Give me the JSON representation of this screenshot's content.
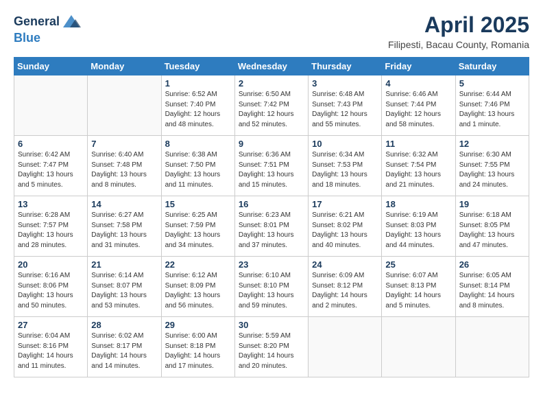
{
  "header": {
    "logo_general": "General",
    "logo_blue": "Blue",
    "title": "April 2025",
    "subtitle": "Filipesti, Bacau County, Romania"
  },
  "weekdays": [
    "Sunday",
    "Monday",
    "Tuesday",
    "Wednesday",
    "Thursday",
    "Friday",
    "Saturday"
  ],
  "weeks": [
    [
      {
        "day": "",
        "detail": ""
      },
      {
        "day": "",
        "detail": ""
      },
      {
        "day": "1",
        "detail": "Sunrise: 6:52 AM\nSunset: 7:40 PM\nDaylight: 12 hours\nand 48 minutes."
      },
      {
        "day": "2",
        "detail": "Sunrise: 6:50 AM\nSunset: 7:42 PM\nDaylight: 12 hours\nand 52 minutes."
      },
      {
        "day": "3",
        "detail": "Sunrise: 6:48 AM\nSunset: 7:43 PM\nDaylight: 12 hours\nand 55 minutes."
      },
      {
        "day": "4",
        "detail": "Sunrise: 6:46 AM\nSunset: 7:44 PM\nDaylight: 12 hours\nand 58 minutes."
      },
      {
        "day": "5",
        "detail": "Sunrise: 6:44 AM\nSunset: 7:46 PM\nDaylight: 13 hours\nand 1 minute."
      }
    ],
    [
      {
        "day": "6",
        "detail": "Sunrise: 6:42 AM\nSunset: 7:47 PM\nDaylight: 13 hours\nand 5 minutes."
      },
      {
        "day": "7",
        "detail": "Sunrise: 6:40 AM\nSunset: 7:48 PM\nDaylight: 13 hours\nand 8 minutes."
      },
      {
        "day": "8",
        "detail": "Sunrise: 6:38 AM\nSunset: 7:50 PM\nDaylight: 13 hours\nand 11 minutes."
      },
      {
        "day": "9",
        "detail": "Sunrise: 6:36 AM\nSunset: 7:51 PM\nDaylight: 13 hours\nand 15 minutes."
      },
      {
        "day": "10",
        "detail": "Sunrise: 6:34 AM\nSunset: 7:53 PM\nDaylight: 13 hours\nand 18 minutes."
      },
      {
        "day": "11",
        "detail": "Sunrise: 6:32 AM\nSunset: 7:54 PM\nDaylight: 13 hours\nand 21 minutes."
      },
      {
        "day": "12",
        "detail": "Sunrise: 6:30 AM\nSunset: 7:55 PM\nDaylight: 13 hours\nand 24 minutes."
      }
    ],
    [
      {
        "day": "13",
        "detail": "Sunrise: 6:28 AM\nSunset: 7:57 PM\nDaylight: 13 hours\nand 28 minutes."
      },
      {
        "day": "14",
        "detail": "Sunrise: 6:27 AM\nSunset: 7:58 PM\nDaylight: 13 hours\nand 31 minutes."
      },
      {
        "day": "15",
        "detail": "Sunrise: 6:25 AM\nSunset: 7:59 PM\nDaylight: 13 hours\nand 34 minutes."
      },
      {
        "day": "16",
        "detail": "Sunrise: 6:23 AM\nSunset: 8:01 PM\nDaylight: 13 hours\nand 37 minutes."
      },
      {
        "day": "17",
        "detail": "Sunrise: 6:21 AM\nSunset: 8:02 PM\nDaylight: 13 hours\nand 40 minutes."
      },
      {
        "day": "18",
        "detail": "Sunrise: 6:19 AM\nSunset: 8:03 PM\nDaylight: 13 hours\nand 44 minutes."
      },
      {
        "day": "19",
        "detail": "Sunrise: 6:18 AM\nSunset: 8:05 PM\nDaylight: 13 hours\nand 47 minutes."
      }
    ],
    [
      {
        "day": "20",
        "detail": "Sunrise: 6:16 AM\nSunset: 8:06 PM\nDaylight: 13 hours\nand 50 minutes."
      },
      {
        "day": "21",
        "detail": "Sunrise: 6:14 AM\nSunset: 8:07 PM\nDaylight: 13 hours\nand 53 minutes."
      },
      {
        "day": "22",
        "detail": "Sunrise: 6:12 AM\nSunset: 8:09 PM\nDaylight: 13 hours\nand 56 minutes."
      },
      {
        "day": "23",
        "detail": "Sunrise: 6:10 AM\nSunset: 8:10 PM\nDaylight: 13 hours\nand 59 minutes."
      },
      {
        "day": "24",
        "detail": "Sunrise: 6:09 AM\nSunset: 8:12 PM\nDaylight: 14 hours\nand 2 minutes."
      },
      {
        "day": "25",
        "detail": "Sunrise: 6:07 AM\nSunset: 8:13 PM\nDaylight: 14 hours\nand 5 minutes."
      },
      {
        "day": "26",
        "detail": "Sunrise: 6:05 AM\nSunset: 8:14 PM\nDaylight: 14 hours\nand 8 minutes."
      }
    ],
    [
      {
        "day": "27",
        "detail": "Sunrise: 6:04 AM\nSunset: 8:16 PM\nDaylight: 14 hours\nand 11 minutes."
      },
      {
        "day": "28",
        "detail": "Sunrise: 6:02 AM\nSunset: 8:17 PM\nDaylight: 14 hours\nand 14 minutes."
      },
      {
        "day": "29",
        "detail": "Sunrise: 6:00 AM\nSunset: 8:18 PM\nDaylight: 14 hours\nand 17 minutes."
      },
      {
        "day": "30",
        "detail": "Sunrise: 5:59 AM\nSunset: 8:20 PM\nDaylight: 14 hours\nand 20 minutes."
      },
      {
        "day": "",
        "detail": ""
      },
      {
        "day": "",
        "detail": ""
      },
      {
        "day": "",
        "detail": ""
      }
    ]
  ]
}
